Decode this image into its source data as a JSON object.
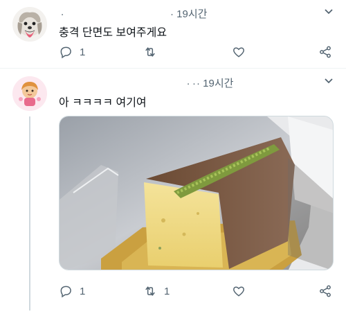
{
  "tweets": [
    {
      "author": ".",
      "time": "19시간",
      "text": "충격 단면도 보여주게요",
      "avatar_icon": "shih-tzu-dog-avatar",
      "actions": {
        "reply_count": "1",
        "retweet_count": "",
        "like_count": ""
      }
    },
    {
      "author": ". .",
      "time": "19시간",
      "text": "아 ㅋㅋㅋㅋ 여기여",
      "avatar_icon": "cartoon-character-avatar",
      "media": {
        "description_icon": "pound-cake-cross-section-photo"
      },
      "actions": {
        "reply_count": "1",
        "retweet_count": "1",
        "like_count": ""
      }
    }
  ],
  "colors": {
    "text": "#0f1419",
    "secondary": "#536471",
    "line": "#cfd9de"
  }
}
